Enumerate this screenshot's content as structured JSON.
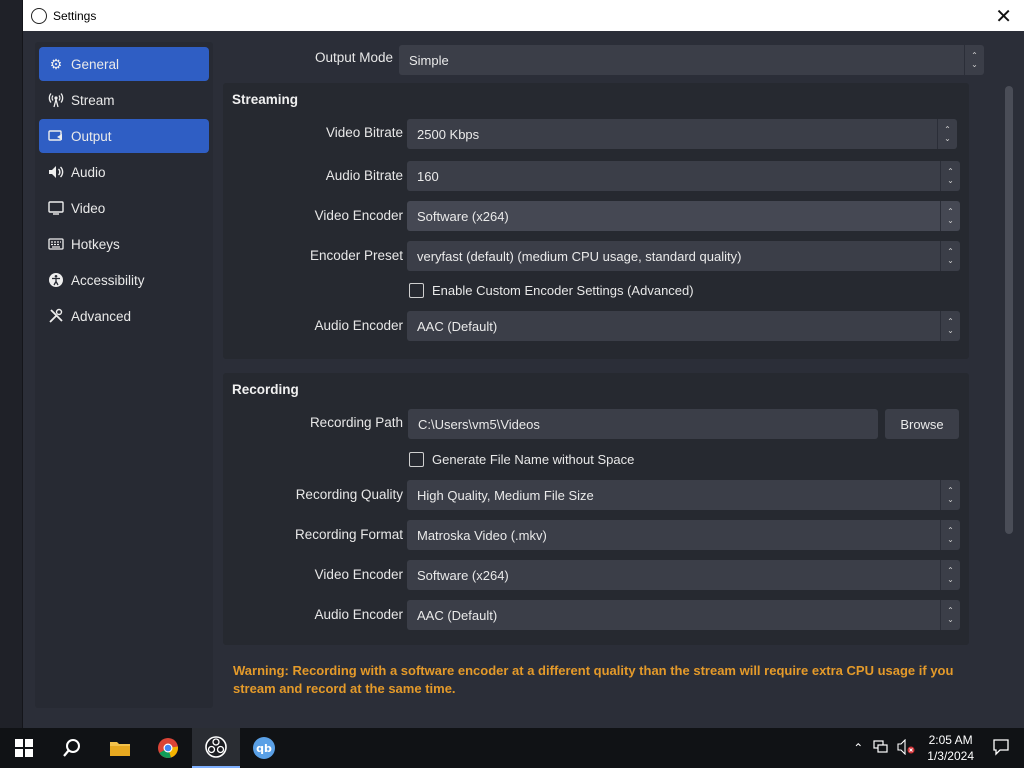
{
  "window": {
    "title": "Settings"
  },
  "sidebar": {
    "items": [
      {
        "label": "General",
        "icon": "gear-icon",
        "selected": true
      },
      {
        "label": "Stream",
        "icon": "antenna-icon",
        "selected": false
      },
      {
        "label": "Output",
        "icon": "output-icon",
        "selected": true
      },
      {
        "label": "Audio",
        "icon": "speaker-icon",
        "selected": false
      },
      {
        "label": "Video",
        "icon": "monitor-icon",
        "selected": false
      },
      {
        "label": "Hotkeys",
        "icon": "keyboard-icon",
        "selected": false
      },
      {
        "label": "Accessibility",
        "icon": "accessibility-icon",
        "selected": false
      },
      {
        "label": "Advanced",
        "icon": "wrench-icon",
        "selected": false
      }
    ]
  },
  "output_mode": {
    "label": "Output Mode",
    "value": "Simple"
  },
  "streaming": {
    "title": "Streaming",
    "video_bitrate": {
      "label": "Video Bitrate",
      "value": "2500 Kbps"
    },
    "audio_bitrate": {
      "label": "Audio Bitrate",
      "value": "160"
    },
    "video_encoder": {
      "label": "Video Encoder",
      "value": "Software (x264)"
    },
    "encoder_preset": {
      "label": "Encoder Preset",
      "value": "veryfast (default) (medium CPU usage, standard quality)"
    },
    "custom_encoder": {
      "label": "Enable Custom Encoder Settings (Advanced)",
      "checked": false
    },
    "audio_encoder": {
      "label": "Audio Encoder",
      "value": "AAC (Default)"
    }
  },
  "recording": {
    "title": "Recording",
    "path": {
      "label": "Recording Path",
      "value": "C:\\Users\\vm5\\Videos",
      "browse": "Browse"
    },
    "no_space": {
      "label": "Generate File Name without Space",
      "checked": false
    },
    "quality": {
      "label": "Recording Quality",
      "value": "High Quality, Medium File Size"
    },
    "format": {
      "label": "Recording Format",
      "value": "Matroska Video (.mkv)"
    },
    "video_encoder": {
      "label": "Video Encoder",
      "value": "Software (x264)"
    },
    "audio_encoder": {
      "label": "Audio Encoder",
      "value": "AAC (Default)"
    }
  },
  "warning": "Warning: Recording with a software encoder at a different quality than the stream will require extra CPU usage if you stream and record at the same time.",
  "taskbar": {
    "time": "2:05 AM",
    "date": "1/3/2024"
  },
  "colors": {
    "accent": "#2f5ec4",
    "warning": "#e49a2a"
  }
}
